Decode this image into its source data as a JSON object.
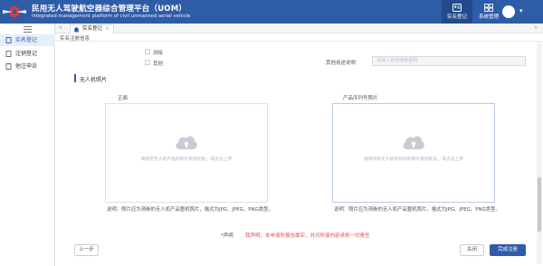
{
  "header": {
    "title": "民用无人驾驶航空器综合管理平台（UOM）",
    "subtitle": "Integrated management platform of civil unmanned aerial vehicle",
    "nav": [
      {
        "label": "实名登记",
        "icon": "id-card-icon",
        "active": true
      },
      {
        "label": "系统管理",
        "icon": "grid-icon",
        "active": false
      }
    ]
  },
  "sidebar": {
    "items": [
      {
        "label": "实名登记",
        "icon": "document-icon",
        "active": true
      },
      {
        "label": "注销登记",
        "icon": "document-icon",
        "active": false
      },
      {
        "label": "他注申诉",
        "icon": "document-icon",
        "active": false
      }
    ]
  },
  "tabs": {
    "open_tab": "实名登记"
  },
  "breadcrumb": "实名注册信息",
  "form": {
    "purpose_options": [
      {
        "label": "测绘",
        "checked": false
      },
      {
        "label": "其他",
        "checked": false
      }
    ],
    "other_purpose": {
      "label": "其他用途说明",
      "placeholder": "请输入其他用途说明"
    }
  },
  "photo_section": {
    "title": "无人机照片",
    "front": {
      "label": "正面",
      "hint": "请将您无人机产品的照片拖到此处，或点击上传",
      "note": "说明：照片应为清晰的无人机产品整机照片，格式为JPG、JPEG、PNG类型。"
    },
    "serial": {
      "label": "产品序列号照片",
      "hint": "请将印有无人机序列号的照片拖到此处，或点击上传",
      "note": "说明：照片应为清晰的无人机产品整机照片，格式为JPG、JPEG、PNG类型。"
    }
  },
  "declaration": {
    "label": "*声明",
    "text": "我声明，本申请所报告属实，并对所填内容承担一切责任"
  },
  "buttons": {
    "prev": "上一步",
    "close": "关闭",
    "done": "完成注册"
  },
  "colors": {
    "brand": "#2e5ca7",
    "warning": "#e34d4d"
  }
}
